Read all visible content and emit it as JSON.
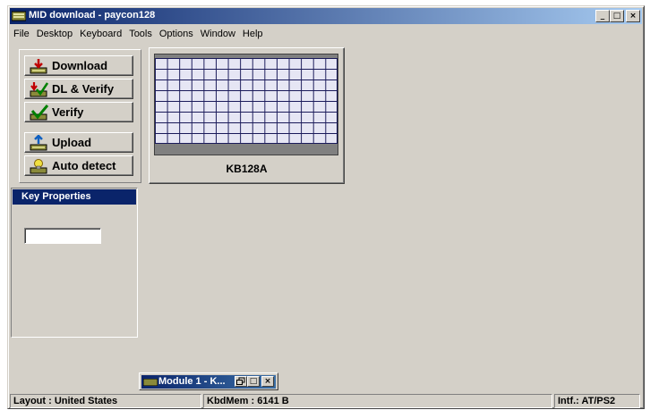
{
  "window": {
    "title": "MID download - paycon128"
  },
  "menu": [
    "File",
    "Desktop",
    "Keyboard",
    "Tools",
    "Options",
    "Window",
    "Help"
  ],
  "titlebar_buttons": {
    "minimize": "_",
    "maximize": "□",
    "close": "×"
  },
  "toolbar": {
    "download": "Download",
    "dl_verify": "DL & Verify",
    "verify": "Verify",
    "upload": "Upload",
    "auto_detect": "Auto detect"
  },
  "keyboard": {
    "model": "KB128A"
  },
  "key_properties": {
    "title": "Key Properties",
    "value": ""
  },
  "minimized_window": {
    "title": "Module 1 - K..."
  },
  "status": {
    "layout": "Layout : United States",
    "memory": "KbdMem : 6141 B",
    "interface": "Intf.: AT/PS2"
  },
  "colors": {
    "title_active": "#0a246a",
    "face": "#d4d0c8",
    "grid_bg": "#e6e6f4"
  }
}
